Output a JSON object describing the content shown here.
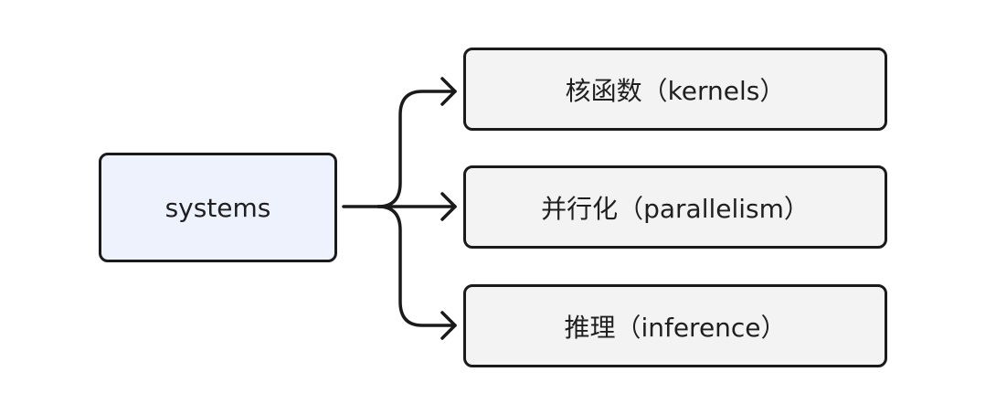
{
  "root": {
    "label": "systems",
    "fill": "#eef2fc"
  },
  "children": [
    {
      "label": "核函数（kernels）"
    },
    {
      "label": "并行化（parallelism）"
    },
    {
      "label": "推理（inference）"
    }
  ],
  "colors": {
    "stroke": "#1a1a1a",
    "child_fill": "#f3f3f3",
    "text": "#1f1f1f",
    "background": "#ffffff"
  }
}
